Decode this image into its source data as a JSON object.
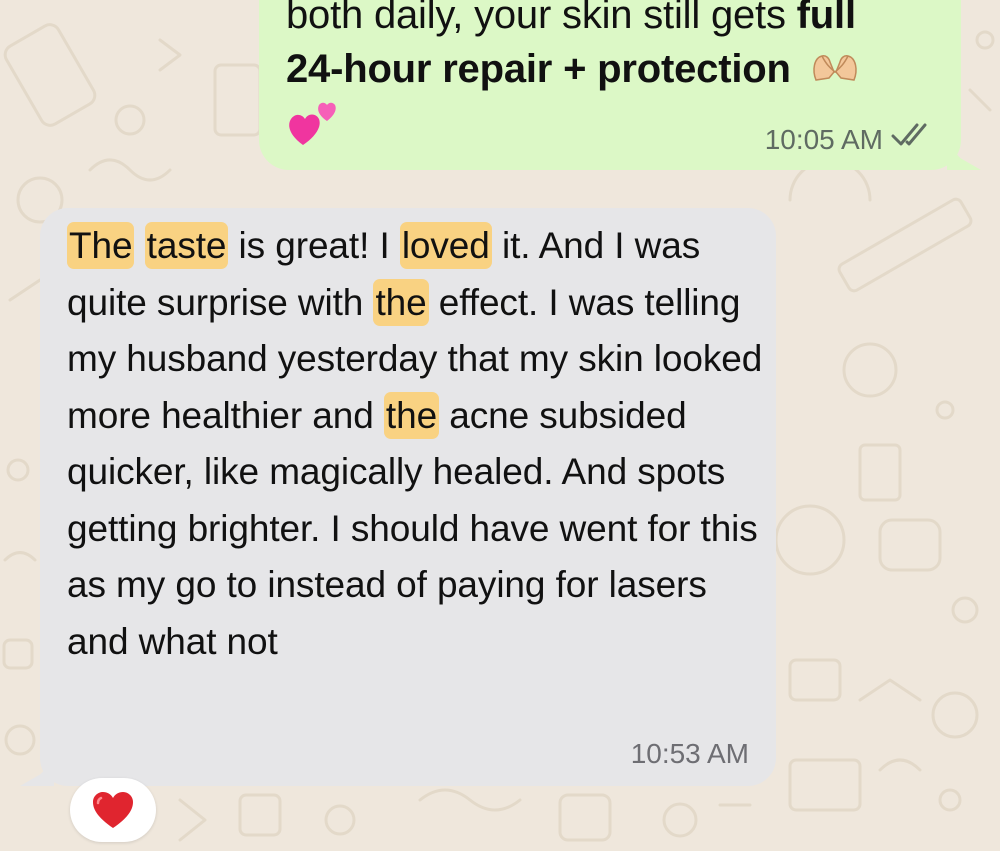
{
  "outgoing": {
    "line1_prefix": "both daily, your skin still gets ",
    "line1_bold": "full",
    "line2_bold": "24-hour repair + protection",
    "emoji_hands": "heart-hands-emoji",
    "emoji_hearts": "two-hearts-emoji",
    "time": "10:05 AM",
    "read_status": "double-check-icon"
  },
  "incoming": {
    "text_parts": [
      "The",
      " ",
      "taste",
      " is great! I ",
      "loved",
      " it. And I was quite surprise with ",
      "the",
      " effect. I was telling my husband yesterday that my skin looked more healthier and ",
      "the",
      " acne subsided quicker, like magically healed. And spots getting brighter. I should have went for this as my go to instead of paying for lasers and what not"
    ],
    "time": "10:53 AM"
  },
  "reaction": {
    "emoji": "red-heart-emoji"
  },
  "colors": {
    "wallpaper": "#efe7dc",
    "outgoing_bubble": "#dcf8c6",
    "incoming_bubble": "#e6e6e8",
    "highlight": "#f9d282",
    "heart": "#e0252f"
  }
}
